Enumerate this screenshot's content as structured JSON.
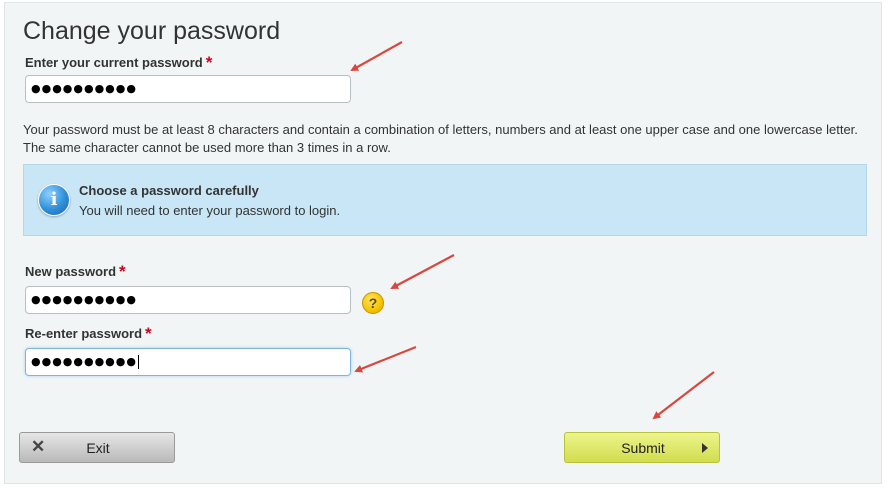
{
  "page": {
    "title": "Change your password"
  },
  "current_password": {
    "label": "Enter your current password",
    "required_mark": "*",
    "value": "●●●●●●●●●●"
  },
  "rules_text": "Your password must be at least 8 characters and contain a combination of letters, numbers and at least one upper case and one lowercase letter. The same character cannot be used more than 3 times in a row.",
  "info": {
    "icon": "info-icon",
    "title": "Choose a password carefully",
    "body": "You will need to enter your password to login."
  },
  "new_password": {
    "label": "New password",
    "required_mark": "*",
    "value": "●●●●●●●●●●",
    "help_glyph": "?"
  },
  "reenter_password": {
    "label": "Re-enter password",
    "required_mark": "*",
    "value": "●●●●●●●●●●"
  },
  "buttons": {
    "exit_glyph": "✕",
    "exit": "Exit",
    "submit": "Submit"
  },
  "colors": {
    "annotation_arrow": "#d9473f",
    "submit_bg": "#e2ea6b",
    "info_bg": "#c8e6f5",
    "required": "#d0021b"
  }
}
